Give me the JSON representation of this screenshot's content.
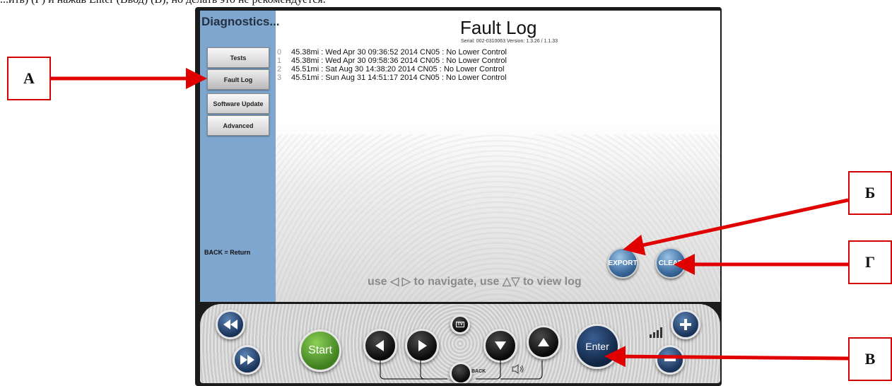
{
  "caption": "...ить) (Г) и нажав Enter (Ввод) (В), но делать это не рекомендуется.",
  "sidebar": {
    "title": "Diagnostics...",
    "items": [
      {
        "label": "Tests"
      },
      {
        "label": "Fault Log"
      },
      {
        "label": "Software Update"
      },
      {
        "label": "Advanced"
      }
    ],
    "back_hint": "BACK = Return"
  },
  "main": {
    "title": "Fault Log",
    "serial": "Serial: 002-0310063   Version: 1.3.26 / 1.1.33",
    "log": [
      {
        "idx": "0",
        "text": "45.38mi :  Wed Apr 30 09:36:52 2014  CN05 : No Lower Control"
      },
      {
        "idx": "1",
        "text": "45.38mi :  Wed Apr 30 09:58:36 2014  CN05 : No Lower Control"
      },
      {
        "idx": "2",
        "text": "45.51mi :  Sat Aug 30 14:38:20 2014  CN05 : No Lower Control"
      },
      {
        "idx": "3",
        "text": "45.51mi :  Sun Aug 31 14:51:17 2014  CN05 : No Lower Control"
      }
    ],
    "export_label": "EXPORT",
    "clear_label": "CLEAR",
    "nav_hint": "use ◁ ▷ to navigate, use △▽ to view log"
  },
  "console": {
    "start_label": "Start",
    "enter_label": "Enter",
    "back_label": "BACK",
    "tv_label": "TV"
  },
  "callouts": {
    "a": "А",
    "b": "Б",
    "g": "Г",
    "v": "В"
  },
  "colors": {
    "sidebar": "#7ea6cf",
    "arrow": "#e00000",
    "start": "#5aa531",
    "enter": "#1a3358"
  }
}
